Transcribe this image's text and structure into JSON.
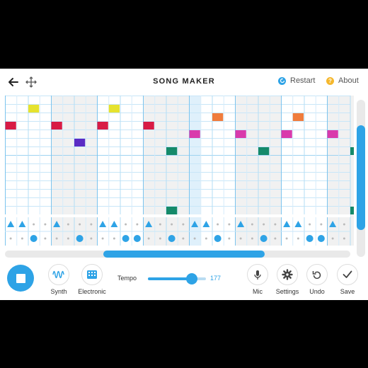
{
  "header": {
    "title": "SONG MAKER",
    "restart_label": "Restart",
    "about_label": "About",
    "about_icon_glyph": "?"
  },
  "grid": {
    "columns": 32,
    "visible_columns_first": 0,
    "melody_rows": 14,
    "rhythm_rows": 2,
    "playhead_column": 16,
    "notes": [
      {
        "col": 2,
        "row": 1,
        "color": "#e6e22e"
      },
      {
        "col": 9,
        "row": 1,
        "color": "#e6e22e"
      },
      {
        "col": 0,
        "row": 3,
        "color": "#d81b45"
      },
      {
        "col": 4,
        "row": 3,
        "color": "#d81b45"
      },
      {
        "col": 8,
        "row": 3,
        "color": "#d81b45"
      },
      {
        "col": 12,
        "row": 3,
        "color": "#d81b45"
      },
      {
        "col": 18,
        "row": 2,
        "color": "#f07c3c"
      },
      {
        "col": 25,
        "row": 2,
        "color": "#f07c3c"
      },
      {
        "col": 16,
        "row": 4,
        "color": "#d93aac"
      },
      {
        "col": 20,
        "row": 4,
        "color": "#d93aac"
      },
      {
        "col": 24,
        "row": 4,
        "color": "#d93aac"
      },
      {
        "col": 28,
        "row": 4,
        "color": "#d93aac"
      },
      {
        "col": 6,
        "row": 5,
        "color": "#5a2bc4"
      },
      {
        "col": 14,
        "row": 6,
        "color": "#158a6a"
      },
      {
        "col": 22,
        "row": 6,
        "color": "#158a6a"
      },
      {
        "col": 30,
        "row": 6,
        "color": "#158a6a"
      },
      {
        "col": 14,
        "row": 13,
        "color": "#158a6a"
      },
      {
        "col": 30,
        "row": 13,
        "color": "#158a6a"
      }
    ],
    "triangles": [
      0,
      1,
      4,
      8,
      9,
      12,
      16,
      17,
      20,
      24,
      25,
      28
    ],
    "circles": [
      2,
      6,
      10,
      11,
      14,
      18,
      22,
      26,
      27,
      30
    ],
    "note_color_accent": "#2ea3e6"
  },
  "footer": {
    "synth_label": "Synth",
    "electronic_label": "Electronic",
    "tempo_label": "Tempo",
    "tempo_value": "177",
    "mic_label": "Mic",
    "settings_label": "Settings",
    "undo_label": "Undo",
    "save_label": "Save"
  },
  "colors": {
    "accent": "#2ea3e6",
    "about_icon": "#f5b82e"
  }
}
